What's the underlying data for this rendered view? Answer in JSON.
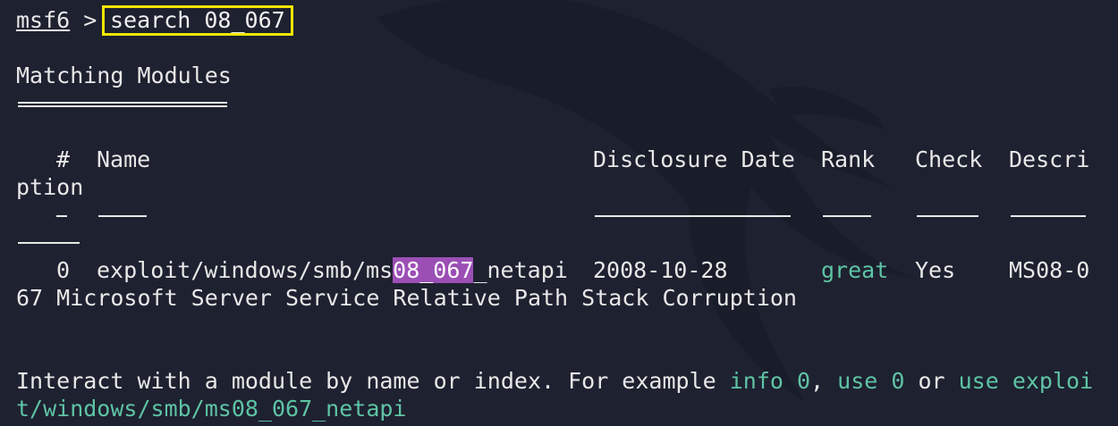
{
  "prompt": {
    "name": "msf6",
    "separator": ">"
  },
  "command": "search 08_067",
  "heading": "Matching Modules",
  "table": {
    "headers": {
      "index": "#",
      "name": "Name",
      "date": "Disclosure Date",
      "rank": "Rank",
      "check": "Check",
      "description_part1": "Descri",
      "description_part2": "ption"
    },
    "rows": [
      {
        "index": "0",
        "name_prefix": "exploit/windows/smb/ms",
        "name_match": "08_067",
        "name_suffix": "_netapi",
        "date": "2008-10-28",
        "rank": "great",
        "check": "Yes",
        "description_part1": "MS08-0",
        "description_part2": "67 Microsoft Server Service Relative Path Stack Corruption"
      }
    ]
  },
  "footer": {
    "text1": "Interact with a module by name or index. For example ",
    "cmd1": "info 0",
    "text2": ", ",
    "cmd2": "use 0",
    "text3": " or ",
    "cmd3_part1": "use exploi",
    "cmd3_part2": "t/windows/smb/ms08_067_netapi"
  },
  "colors": {
    "background": "#1e2130",
    "foreground": "#e8e8e8",
    "accent_green": "#5ec4a4",
    "match_highlight": "#9b4fb5",
    "command_box_border": "#f2e600"
  },
  "icons": {
    "watermark": "kali-dragon-icon"
  }
}
